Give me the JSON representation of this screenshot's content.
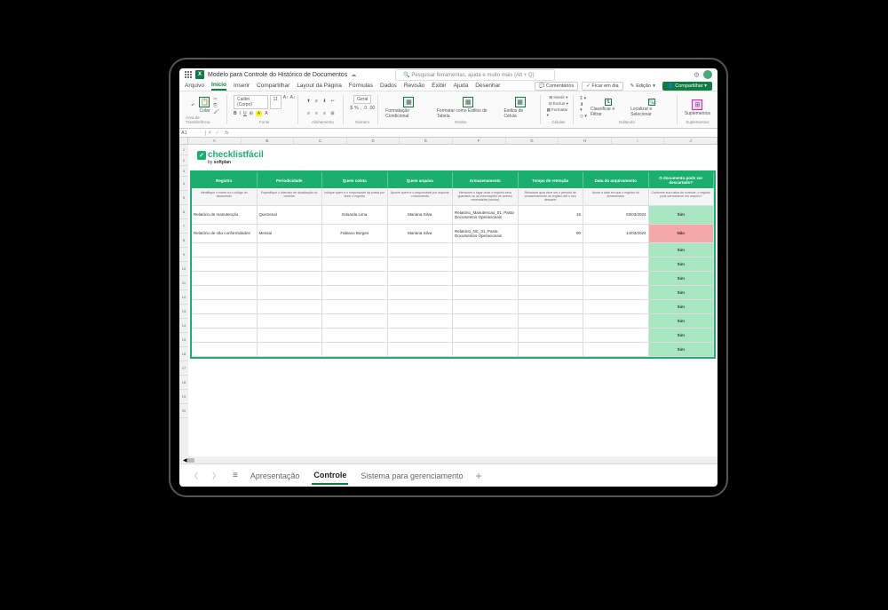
{
  "title": "Modelo para Controle do Histórico de Documentos",
  "search_placeholder": "Pesquisar ferramentas, ajuda e muito mais (Alt + Q)",
  "menu": {
    "arquivo": "Arquivo",
    "inicio": "Início",
    "inserir": "Inserir",
    "compartilhar": "Compartilhar",
    "layout": "Layout da Página",
    "formulas": "Fórmulas",
    "dados": "Dados",
    "revisao": "Revisão",
    "exibir": "Exibir",
    "ajuda": "Ajuda",
    "desenhar": "Desenhar",
    "comentarios": "Comentários",
    "ficar": "Ficar em dia",
    "edicao": "Edição",
    "compartilhar_btn": "Compartilhar"
  },
  "ribbon": {
    "colar": "Colar",
    "area": "Área de Transferência",
    "font_name": "Calibri (Corpo)",
    "font_size": "11",
    "fonte": "Fonte",
    "alinhamento": "Alinhamento",
    "geral": "Geral",
    "numero": "Número",
    "fmt_cond": "Formatação Condicional",
    "fmt_tabela": "Formatar como Estilos de Tabela",
    "estilos_celula": "Estilos de Célula",
    "estilos": "Estilos",
    "inserir": "Inserir",
    "excluir": "Excluir",
    "formatar": "Formatar",
    "celulas": "Células",
    "classificar": "Classificar e Filtrar",
    "localizar": "Localizar e Selecionar",
    "editando": "Editando",
    "suplementos": "Suplementos",
    "suplementos_grp": "Suplementos"
  },
  "name_box": "A1",
  "brand": {
    "name": "checklistfácil",
    "by": "by",
    "company": "softplan"
  },
  "table": {
    "headers": {
      "registro": "Registro",
      "periodicidade": "Periodicidade",
      "quem_coleta": "Quem coleta",
      "quem_arquiva": "Quem arquiva",
      "armazenamento": "Armazenamento",
      "tempo": "Tempo de retenção",
      "data": "Data do arquivamento",
      "descartado": "O documento pode ser descartado?"
    },
    "subheaders": {
      "registro": "Identifique o nome ou o código do documento",
      "periodicidade": "Especifique o intervalo de atualização do controle",
      "quem_coleta": "Indique quem é o responsável da coleta por fazer o registro",
      "quem_arquiva": "Aponte quem é o responsável por arquivar o documento",
      "armazenamento": "Mencione o lugar onde o registro será guardado ou as informações de acesso necessárias (senha)",
      "tempo": "Relacione qual deve ser o período de armazenamento do registro até o seu descarte",
      "data": "Anote a data em que o registro foi armazenado",
      "descartado": "Conforme sua rotina de controle, o registro pode permanecer em arquivo?"
    },
    "rows": [
      {
        "registro": "Relatório de manutenção",
        "periodicidade": "Quinzenal",
        "quem_coleta": "Eduarda Lima",
        "quem_arquiva": "Mariana Silva",
        "armazenamento": "Relatório_Manutencao_01, Pasta Documentos Operacionais",
        "tempo": "15",
        "data": "03/03/2024",
        "descartado": "Sim",
        "status_class": "status-sim"
      },
      {
        "registro": "Relatório de não conformidades",
        "periodicidade": "Mensal",
        "quem_coleta": "Fabiano Borges",
        "quem_arquiva": "Mariana Silva",
        "armazenamento": "Relatório_NC_01, Pasta Documentos Operacionais",
        "tempo": "90",
        "data": "14/03/2024",
        "descartado": "Não",
        "status_class": "status-nao"
      }
    ],
    "empty_status": "Sim"
  },
  "tabs": {
    "apresentacao": "Apresentação",
    "controle": "Controle",
    "sistema": "Sistema para gerenciamento"
  }
}
